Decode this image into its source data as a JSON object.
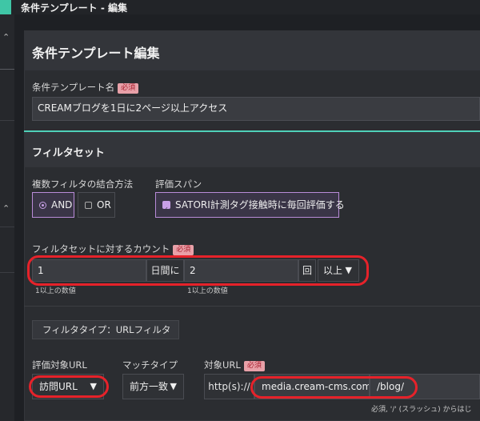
{
  "window": {
    "title": "条件テンプレート - 編集"
  },
  "page": {
    "title": "条件テンプレート編集"
  },
  "template_name": {
    "label": "条件テンプレート名",
    "required_badge": "必須",
    "value": "CREAMブログを1日に2ページ以上アクセス"
  },
  "filter_set": {
    "title": "フィルタセット",
    "combine": {
      "label": "複数フィルタの結合方法",
      "options": [
        "AND",
        "OR"
      ],
      "selected": "AND"
    },
    "eval_span": {
      "label": "評価スパン",
      "checkbox_label": "SATORI計測タグ接触時に毎回評価する",
      "checked": true
    },
    "count": {
      "label": "フィルタセットに対するカウント",
      "required_badge": "必須",
      "days_value": "1",
      "days_suffix": "日間に",
      "times_value": "2",
      "times_suffix": "回",
      "comparator": "以上",
      "days_hint": "1以上の数値",
      "times_hint": "1以上の数値"
    }
  },
  "filter": {
    "type_label": "フィルタタイプ：URLフィルタ",
    "target_label": "評価対象URL",
    "target_value": "訪問URL",
    "match_label": "マッチタイプ",
    "match_value": "前方一致",
    "url_label": "対象URL",
    "url_required_badge": "必須",
    "url_prefix": "http(s)://",
    "url_domain": "media.cream-cms.com",
    "url_path": "/blog/",
    "url_hint": "必須, '/' (スラッシュ) からはじ"
  },
  "icons": {
    "dropdown": "triangle-down-icon",
    "sidebar_chevron": "chevron-up-icon",
    "checkbox": "check-icon"
  },
  "colors": {
    "accent": "#3fc6a6",
    "teal_divider": "#4fd0b8",
    "selected_border": "#b98bd8",
    "highlight_ring": "#e6222a",
    "required_badge_bg": "#e8a0a8"
  }
}
